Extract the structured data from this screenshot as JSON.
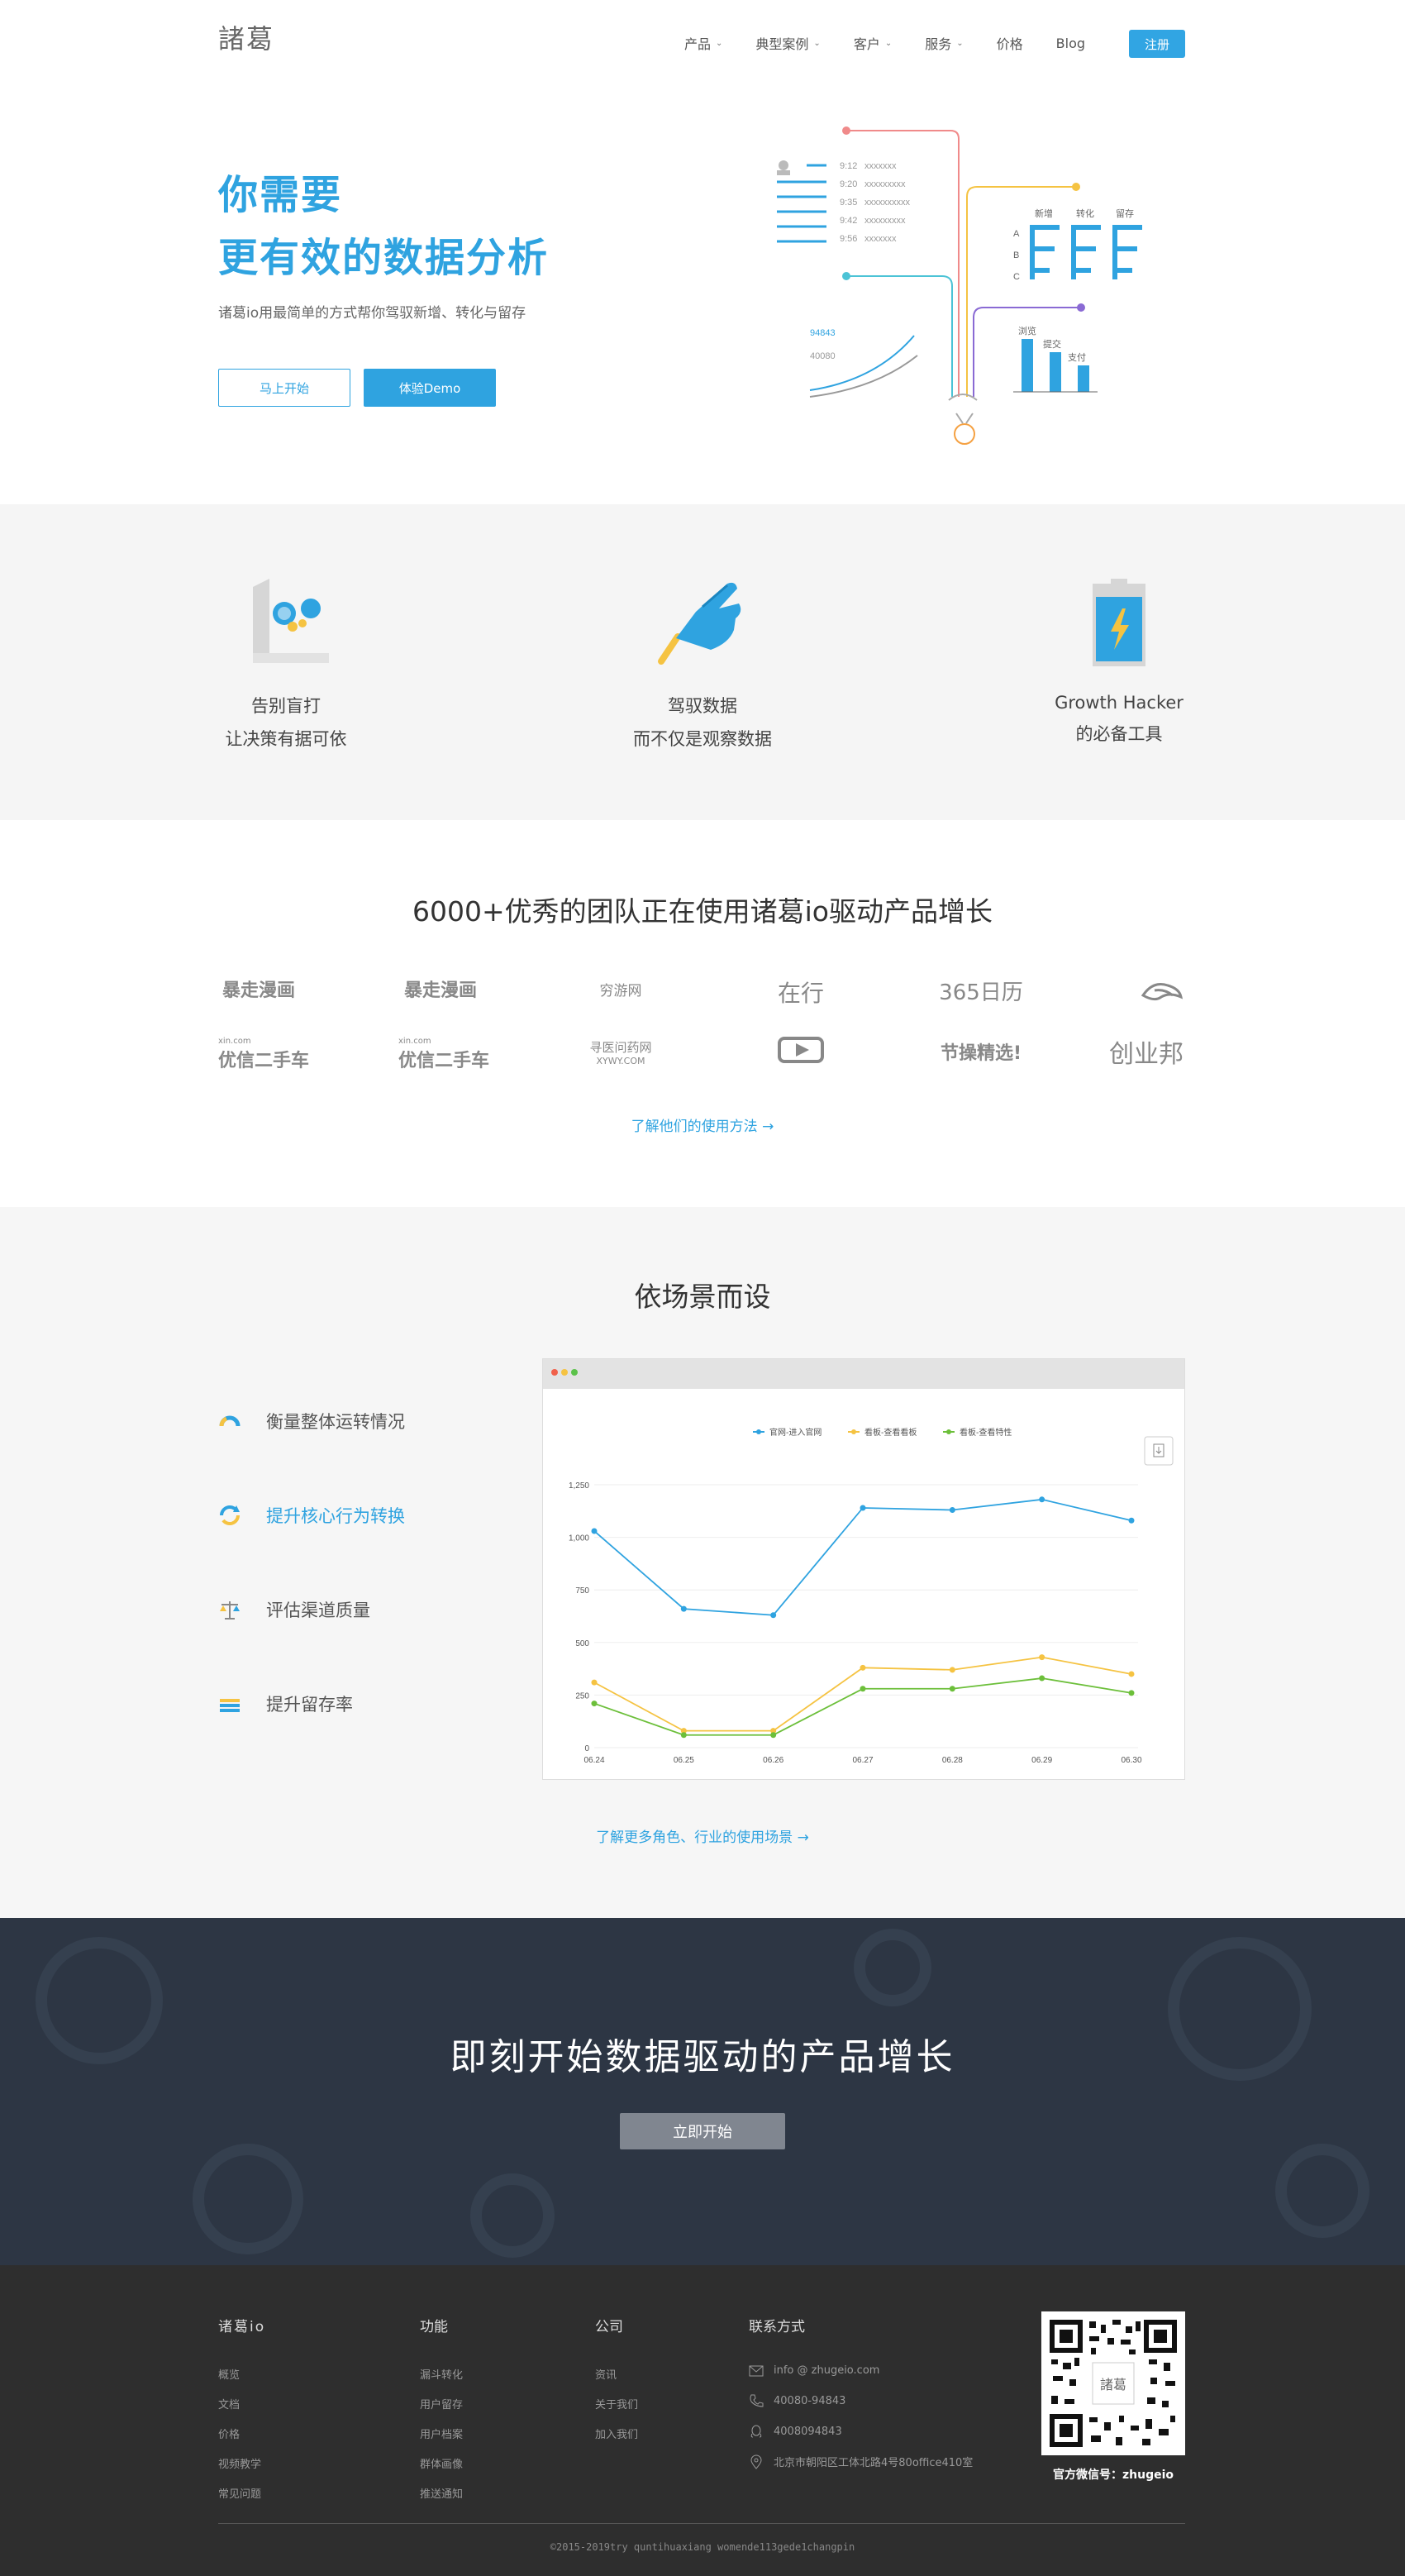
{
  "header": {
    "logo": "諸葛",
    "nav": [
      {
        "label": "产品",
        "dropdown": true
      },
      {
        "label": "典型案例",
        "dropdown": true
      },
      {
        "label": "客户",
        "dropdown": true
      },
      {
        "label": "服务",
        "dropdown": true
      },
      {
        "label": "价格",
        "dropdown": false
      },
      {
        "label": "Blog",
        "dropdown": false
      }
    ],
    "register": "注册"
  },
  "hero": {
    "title_line1": "你需要",
    "title_line2": "更有效的数据分析",
    "subtitle": "诸葛io用最简单的方式帮你驾驭新增、转化与留存",
    "btn_start": "马上开始",
    "btn_demo": "体验Demo",
    "illustration": {
      "times": [
        "9:12",
        "9:20",
        "9:35",
        "9:42",
        "9:56"
      ],
      "masks": [
        "xxxxxxx",
        "xxxxxxxxx",
        "xxxxxxxxxx",
        "xxxxxxxxx",
        "xxxxxxx"
      ],
      "funnel_labels": [
        "新增",
        "转化",
        "留存"
      ],
      "row_labels": [
        "A",
        "B",
        "C"
      ],
      "bar_labels": [
        "浏览",
        "提交",
        "支付"
      ],
      "num1": "94843",
      "num2": "40080"
    }
  },
  "features": [
    {
      "line1": "告别盲打",
      "line2": "让决策有据可依",
      "icon": "chart-board-icon"
    },
    {
      "line1": "驾驭数据",
      "line2": "而不仅是观察数据",
      "icon": "pointing-hand-icon"
    },
    {
      "line1": "Growth Hacker",
      "line2": "的必备工具",
      "icon": "battery-icon"
    }
  ],
  "clients": {
    "title": "6000+优秀的团队正在使用诸葛io驱动产品增长",
    "logos": [
      "暴走漫画",
      "暴走漫画",
      "穷游网",
      "在行",
      "365日历",
      "云鸟",
      "优信二手车",
      "优信二手车",
      "寻医问药网",
      "视频",
      "节操精选!",
      "创业邦"
    ],
    "logo_subs": {
      "yx": "xin.com",
      "xywy": "XYWY.COM"
    },
    "link": "了解他们的使用方法 →"
  },
  "scene": {
    "title": "依场景而设",
    "items": [
      {
        "label": "衡量整体运转情况",
        "active": false
      },
      {
        "label": "提升核心行为转换",
        "active": true
      },
      {
        "label": "评估渠道质量",
        "active": false
      },
      {
        "label": "提升留存率",
        "active": false
      }
    ],
    "link": "了解更多角色、行业的使用场景 →"
  },
  "chart_data": {
    "type": "line",
    "categories": [
      "06.24",
      "06.25",
      "06.26",
      "06.27",
      "06.28",
      "06.29",
      "06.30"
    ],
    "series": [
      {
        "name": "官网-进入官网",
        "color": "#2fa3e0",
        "values": [
          1030,
          660,
          630,
          1140,
          1130,
          1180,
          1080
        ]
      },
      {
        "name": "看板-查看看板",
        "color": "#f5c342",
        "values": [
          310,
          80,
          80,
          380,
          370,
          430,
          350
        ]
      },
      {
        "name": "看板-查看特性",
        "color": "#6cbf3a",
        "values": [
          210,
          60,
          60,
          280,
          280,
          330,
          260
        ]
      }
    ],
    "ylim": [
      0,
      1250
    ],
    "yticks": [
      "0",
      "250",
      "500",
      "750",
      "1,000",
      "1,250"
    ],
    "grid": true,
    "legend": "top-center"
  },
  "cta": {
    "title": "即刻开始数据驱动的产品增长",
    "button": "立即开始"
  },
  "footer": {
    "cols": [
      {
        "title": "诸葛io",
        "links": [
          "概览",
          "文档",
          "价格",
          "视频教学",
          "常见问题"
        ]
      },
      {
        "title": "功能",
        "links": [
          "漏斗转化",
          "用户留存",
          "用户档案",
          "群体画像",
          "推送通知"
        ]
      },
      {
        "title": "公司",
        "links": [
          "资讯",
          "关于我们",
          "加入我们"
        ]
      }
    ],
    "contact_title": "联系方式",
    "contacts": [
      {
        "icon": "mail-icon",
        "text": "info @ zhugeio.com"
      },
      {
        "icon": "phone-icon",
        "text": "40080-94843"
      },
      {
        "icon": "qq-icon",
        "text": "4008094843"
      },
      {
        "icon": "location-icon",
        "text": "北京市朝阳区工体北路4号80office410室"
      }
    ],
    "qr_caption": "官方微信号：zhugeio",
    "qr_center": "諸葛",
    "copyright": "©2015-2019try quntihuaxiang womende113gede1changpin"
  }
}
